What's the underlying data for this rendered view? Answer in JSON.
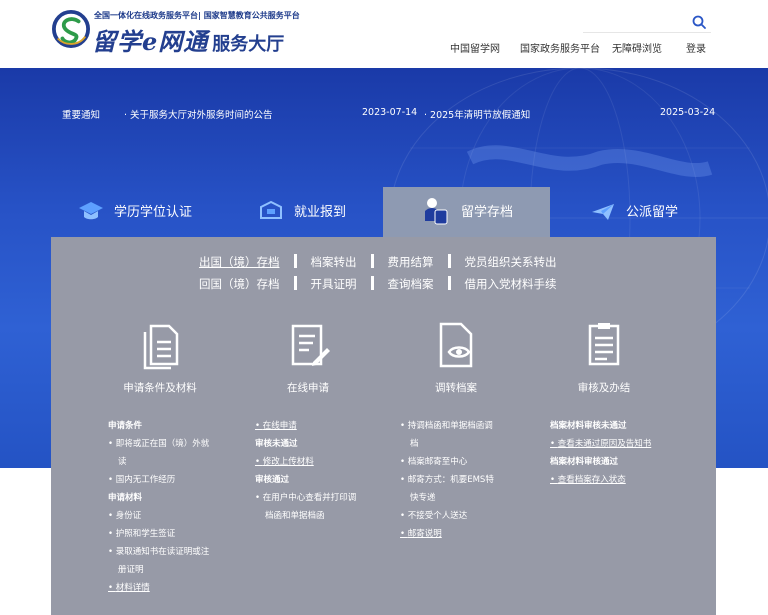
{
  "header": {
    "logo_top": "全国一体化在线政务服务平台| 国家智慧教育公共服务平台",
    "logo_name": "留学e网通",
    "logo_sub": "服务大厅",
    "nav": [
      "中国留学网",
      "国家政务服务平台",
      "无障碍浏览",
      "登录"
    ]
  },
  "notice": {
    "label": "重要通知",
    "items": [
      {
        "title": "· 关于服务大厅对外服务时间的公告",
        "date": "2023-07-14"
      },
      {
        "title": "· 2025年清明节放假通知",
        "date": "2025-03-24"
      }
    ]
  },
  "tabs": [
    {
      "label": "学历学位认证",
      "icon": "graduation-cap-icon"
    },
    {
      "label": "就业报到",
      "icon": "briefcase-icon"
    },
    {
      "label": "留学存档",
      "icon": "archive-person-icon"
    },
    {
      "label": "公派留学",
      "icon": "airplane-icon"
    }
  ],
  "links": {
    "row1": [
      "出国（境）存档",
      "档案转出",
      "费用结算",
      "党员组织关系转出"
    ],
    "row2": [
      "回国（境）存档",
      "开具证明",
      "查询档案",
      "借用入党材料手续"
    ]
  },
  "steps": [
    {
      "label": "申请条件及材料",
      "icon": "documents-icon"
    },
    {
      "label": "在线申请",
      "icon": "form-edit-icon"
    },
    {
      "label": "调转档案",
      "icon": "file-view-icon"
    },
    {
      "label": "审核及办结",
      "icon": "checklist-icon"
    }
  ],
  "cols": {
    "c1": {
      "h1": "申请条件",
      "i1a": "即将或正在国（境）外就",
      "i1b": "读",
      "i2": "国内无工作经历",
      "h2": "申请材料",
      "i3": "身份证",
      "i4": "护照和学生签证",
      "i5a": "录取通知书在读证明或注",
      "i5b": "册证明",
      "i6": "材料详情"
    },
    "c2": {
      "i1": "在线申请",
      "h1": "审核未通过",
      "i2": "修改上传材料",
      "h2": "审核通过",
      "i3a": "在用户中心查看并打印调",
      "i3b": "档函和单据档函"
    },
    "c3": {
      "i1a": "持调档函和单据档函调",
      "i1b": "档",
      "i2": "档案邮寄至中心",
      "i3a": "邮寄方式：机要EMS特",
      "i3b": "快专递",
      "i4": "不接受个人送达",
      "i5": "邮寄说明"
    },
    "c4": {
      "h1": "档案材料审核未通过",
      "i1": "查看未通过原因及告知书",
      "h2": "档案材料审核通过",
      "i2": "查看档案存入状态"
    }
  }
}
